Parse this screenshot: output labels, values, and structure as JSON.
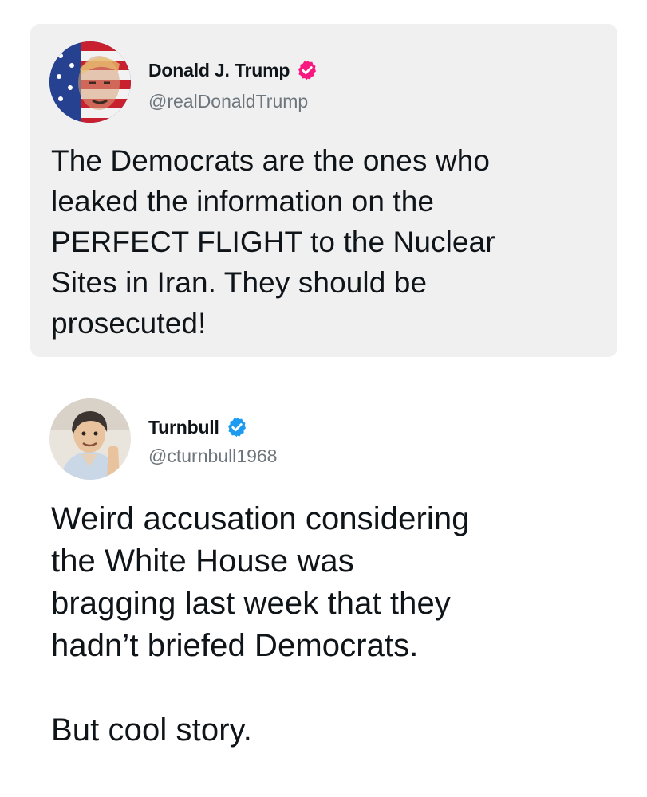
{
  "quoted_post": {
    "display_name": "Donald J. Trump",
    "handle": "@realDonaldTrump",
    "verified_badge_color": "#f91880",
    "avatar_icon": "flag-portrait-avatar",
    "text": "The Democrats are the ones who\nleaked the information on the\nPERFECT FLIGHT to the Nuclear\nSites in Iran. They should be\nprosecuted!"
  },
  "reply_post": {
    "display_name": "Turnbull",
    "handle": "@cturnbull1968",
    "verified_badge_color": "#1d9bf0",
    "avatar_icon": "cartoon-portrait-avatar",
    "text": "Weird accusation considering\nthe White House was\nbragging last week that they\nhadn’t briefed Democrats.\n\nBut cool story."
  },
  "colors": {
    "quote_card_background": "#f0f0f0",
    "handle_text": "#6e767d",
    "body_text": "#0f1419"
  }
}
